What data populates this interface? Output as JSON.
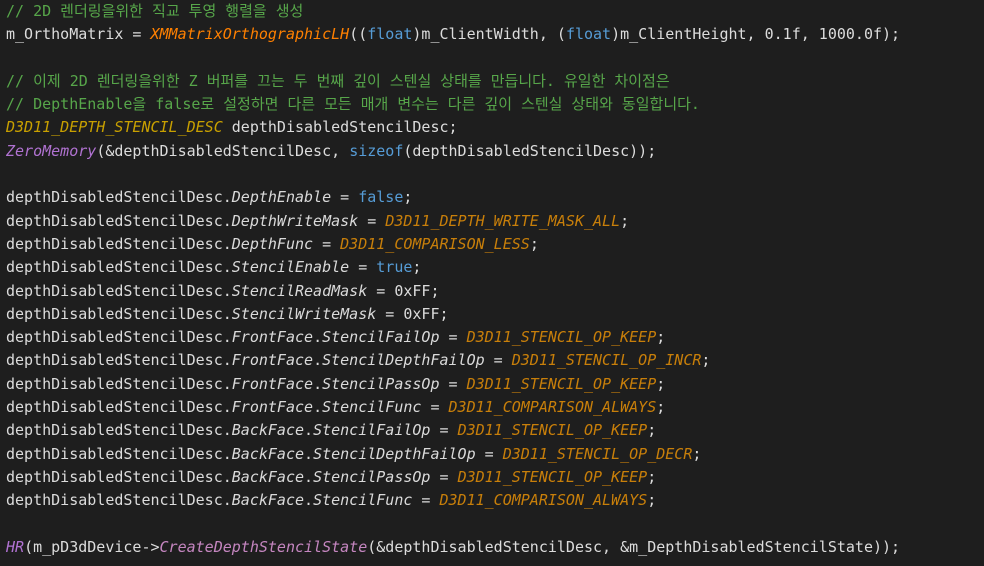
{
  "colors": {
    "background": "#1e1e1e",
    "comment": "#57a64a",
    "default": "#dcdcdc",
    "keyword": "#569cd6",
    "macro_function": "#ff8000",
    "enum_value": "#c87f0a",
    "type": "#c8a000",
    "function": "#b072d1"
  },
  "lines": [
    [
      {
        "t": "// 2D 렌더링을위한 직교 투영 행렬을 생성",
        "c": "comment"
      }
    ],
    [
      {
        "t": "m_OrthoMatrix = ",
        "c": "default"
      },
      {
        "t": "XMMatrixOrthographicLH",
        "c": "macro-fn"
      },
      {
        "t": "((",
        "c": "default"
      },
      {
        "t": "float",
        "c": "keyword"
      },
      {
        "t": ")m_ClientWidth, (",
        "c": "default"
      },
      {
        "t": "float",
        "c": "keyword"
      },
      {
        "t": ")m_ClientHeight, 0.1f, 1000.0f);",
        "c": "default"
      }
    ],
    [],
    [
      {
        "t": "// 이제 2D 렌더링을위한 Z 버퍼를 끄는 두 번째 깊이 스텐실 상태를 만듭니다. 유일한 차이점은",
        "c": "comment"
      }
    ],
    [
      {
        "t": "// DepthEnable을 false로 설정하면 다른 모든 매개 변수는 다른 깊이 스텐실 상태와 동일합니다.",
        "c": "comment"
      }
    ],
    [
      {
        "t": "D3D11_DEPTH_STENCIL_DESC",
        "c": "type"
      },
      {
        "t": " depthDisabledStencilDesc;",
        "c": "default"
      }
    ],
    [
      {
        "t": "ZeroMemory",
        "c": "fn"
      },
      {
        "t": "(&depthDisabledStencilDesc, ",
        "c": "default"
      },
      {
        "t": "sizeof",
        "c": "keyword"
      },
      {
        "t": "(depthDisabledStencilDesc));",
        "c": "default"
      }
    ],
    [],
    [
      {
        "t": "depthDisabledStencilDesc.",
        "c": "default"
      },
      {
        "t": "DepthEnable",
        "c": "member"
      },
      {
        "t": " = ",
        "c": "default"
      },
      {
        "t": "false",
        "c": "keyword"
      },
      {
        "t": ";",
        "c": "default"
      }
    ],
    [
      {
        "t": "depthDisabledStencilDesc.",
        "c": "default"
      },
      {
        "t": "DepthWriteMask",
        "c": "member"
      },
      {
        "t": " = ",
        "c": "default"
      },
      {
        "t": "D3D11_DEPTH_WRITE_MASK_ALL",
        "c": "enumval"
      },
      {
        "t": ";",
        "c": "default"
      }
    ],
    [
      {
        "t": "depthDisabledStencilDesc.",
        "c": "default"
      },
      {
        "t": "DepthFunc",
        "c": "member"
      },
      {
        "t": " = ",
        "c": "default"
      },
      {
        "t": "D3D11_COMPARISON_LESS",
        "c": "enumval"
      },
      {
        "t": ";",
        "c": "default"
      }
    ],
    [
      {
        "t": "depthDisabledStencilDesc.",
        "c": "default"
      },
      {
        "t": "StencilEnable",
        "c": "member"
      },
      {
        "t": " = ",
        "c": "default"
      },
      {
        "t": "true",
        "c": "keyword"
      },
      {
        "t": ";",
        "c": "default"
      }
    ],
    [
      {
        "t": "depthDisabledStencilDesc.",
        "c": "default"
      },
      {
        "t": "StencilReadMask",
        "c": "member"
      },
      {
        "t": " = 0xFF;",
        "c": "default"
      }
    ],
    [
      {
        "t": "depthDisabledStencilDesc.",
        "c": "default"
      },
      {
        "t": "StencilWriteMask",
        "c": "member"
      },
      {
        "t": " = 0xFF;",
        "c": "default"
      }
    ],
    [
      {
        "t": "depthDisabledStencilDesc.",
        "c": "default"
      },
      {
        "t": "FrontFace",
        "c": "member"
      },
      {
        "t": ".",
        "c": "default"
      },
      {
        "t": "StencilFailOp",
        "c": "member"
      },
      {
        "t": " = ",
        "c": "default"
      },
      {
        "t": "D3D11_STENCIL_OP_KEEP",
        "c": "enumval"
      },
      {
        "t": ";",
        "c": "default"
      }
    ],
    [
      {
        "t": "depthDisabledStencilDesc.",
        "c": "default"
      },
      {
        "t": "FrontFace",
        "c": "member"
      },
      {
        "t": ".",
        "c": "default"
      },
      {
        "t": "StencilDepthFailOp",
        "c": "member"
      },
      {
        "t": " = ",
        "c": "default"
      },
      {
        "t": "D3D11_STENCIL_OP_INCR",
        "c": "enumval"
      },
      {
        "t": ";",
        "c": "default"
      }
    ],
    [
      {
        "t": "depthDisabledStencilDesc.",
        "c": "default"
      },
      {
        "t": "FrontFace",
        "c": "member"
      },
      {
        "t": ".",
        "c": "default"
      },
      {
        "t": "StencilPassOp",
        "c": "member"
      },
      {
        "t": " = ",
        "c": "default"
      },
      {
        "t": "D3D11_STENCIL_OP_KEEP",
        "c": "enumval"
      },
      {
        "t": ";",
        "c": "default"
      }
    ],
    [
      {
        "t": "depthDisabledStencilDesc.",
        "c": "default"
      },
      {
        "t": "FrontFace",
        "c": "member"
      },
      {
        "t": ".",
        "c": "default"
      },
      {
        "t": "StencilFunc",
        "c": "member"
      },
      {
        "t": " = ",
        "c": "default"
      },
      {
        "t": "D3D11_COMPARISON_ALWAYS",
        "c": "enumval"
      },
      {
        "t": ";",
        "c": "default"
      }
    ],
    [
      {
        "t": "depthDisabledStencilDesc.",
        "c": "default"
      },
      {
        "t": "BackFace",
        "c": "member"
      },
      {
        "t": ".",
        "c": "default"
      },
      {
        "t": "StencilFailOp",
        "c": "member"
      },
      {
        "t": " = ",
        "c": "default"
      },
      {
        "t": "D3D11_STENCIL_OP_KEEP",
        "c": "enumval"
      },
      {
        "t": ";",
        "c": "default"
      }
    ],
    [
      {
        "t": "depthDisabledStencilDesc.",
        "c": "default"
      },
      {
        "t": "BackFace",
        "c": "member"
      },
      {
        "t": ".",
        "c": "default"
      },
      {
        "t": "StencilDepthFailOp",
        "c": "member"
      },
      {
        "t": " = ",
        "c": "default"
      },
      {
        "t": "D3D11_STENCIL_OP_DECR",
        "c": "enumval"
      },
      {
        "t": ";",
        "c": "default"
      }
    ],
    [
      {
        "t": "depthDisabledStencilDesc.",
        "c": "default"
      },
      {
        "t": "BackFace",
        "c": "member"
      },
      {
        "t": ".",
        "c": "default"
      },
      {
        "t": "StencilPassOp",
        "c": "member"
      },
      {
        "t": " = ",
        "c": "default"
      },
      {
        "t": "D3D11_STENCIL_OP_KEEP",
        "c": "enumval"
      },
      {
        "t": ";",
        "c": "default"
      }
    ],
    [
      {
        "t": "depthDisabledStencilDesc.",
        "c": "default"
      },
      {
        "t": "BackFace",
        "c": "member"
      },
      {
        "t": ".",
        "c": "default"
      },
      {
        "t": "StencilFunc",
        "c": "member"
      },
      {
        "t": " = ",
        "c": "default"
      },
      {
        "t": "D3D11_COMPARISON_ALWAYS",
        "c": "enumval"
      },
      {
        "t": ";",
        "c": "default"
      }
    ],
    [],
    [
      {
        "t": "HR",
        "c": "fn"
      },
      {
        "t": "(m_pD3dDevice->",
        "c": "default"
      },
      {
        "t": "CreateDepthStencilState",
        "c": "method"
      },
      {
        "t": "(&depthDisabledStencilDesc, &m_DepthDisabledStencilState));",
        "c": "default"
      }
    ]
  ]
}
